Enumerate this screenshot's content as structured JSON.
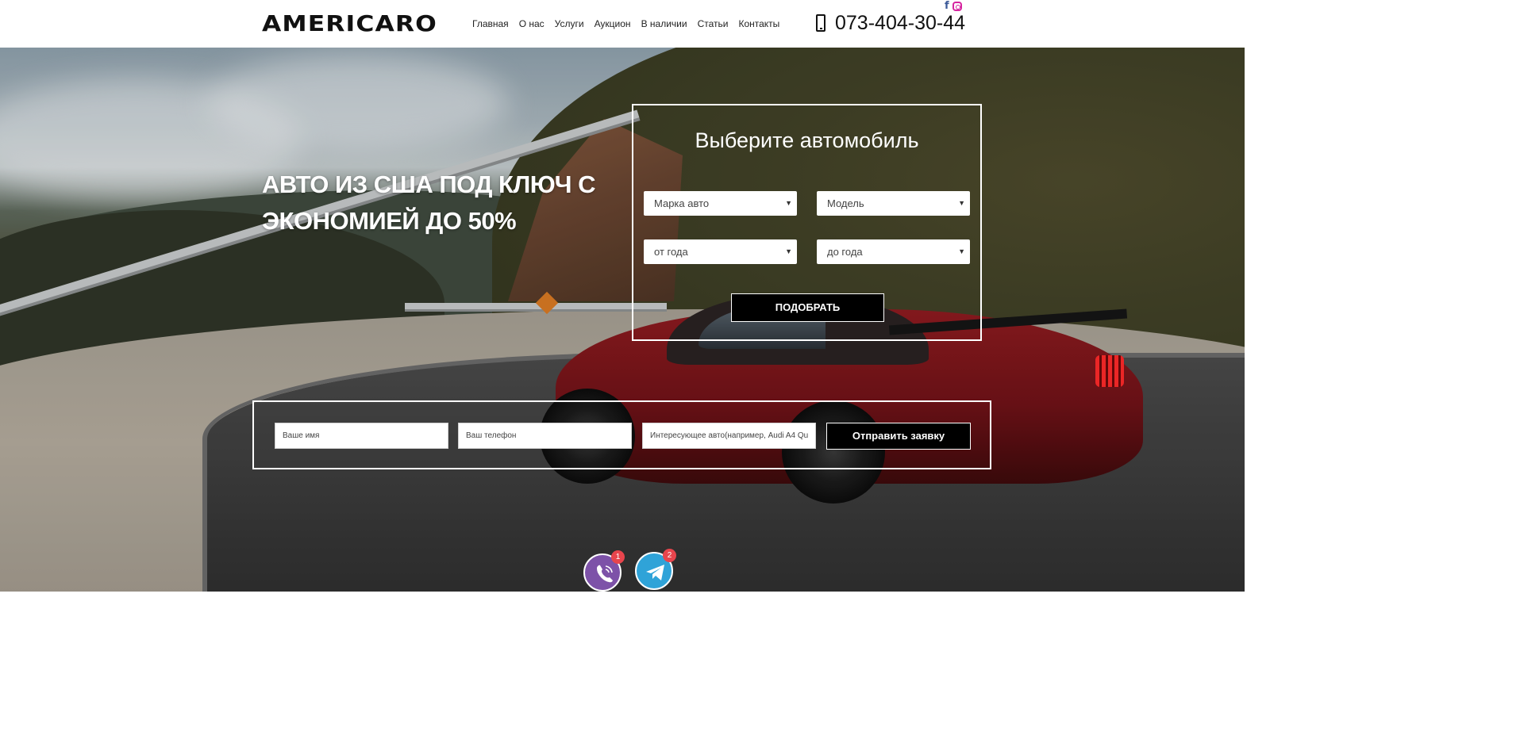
{
  "header": {
    "logo": "AMERICARO",
    "nav": [
      "Главная",
      "О нас",
      "Услуги",
      "Аукцион",
      "В наличии",
      "Статьи",
      "Контакты"
    ],
    "social": {
      "facebook": "f",
      "instagram_icon": "instagram-icon"
    },
    "phone": "073-404-30-44",
    "phone_icon": "mobile-phone-icon"
  },
  "hero": {
    "headline_line1": "АВТО ИЗ США ПОД КЛЮЧ С",
    "headline_line2": "ЭКОНОМИЕЙ ДО 50%"
  },
  "selector": {
    "title": "Выберите автомобиль",
    "make": "Марка авто",
    "model": "Модель",
    "year_from": "от года",
    "year_to": "до года",
    "button": "ПОДОБРАТЬ"
  },
  "form": {
    "name_placeholder": "Ваше имя",
    "phone_placeholder": "Ваш телефон",
    "car_placeholder": "Интересующее авто(например, Audi A4 Qu",
    "submit": "Отправить заявку"
  },
  "messengers": {
    "viber_badge": "1",
    "telegram_badge": "2"
  },
  "colors": {
    "viber": "#7d52a8",
    "telegram": "#2fa3d8",
    "badge": "#e8454d"
  }
}
